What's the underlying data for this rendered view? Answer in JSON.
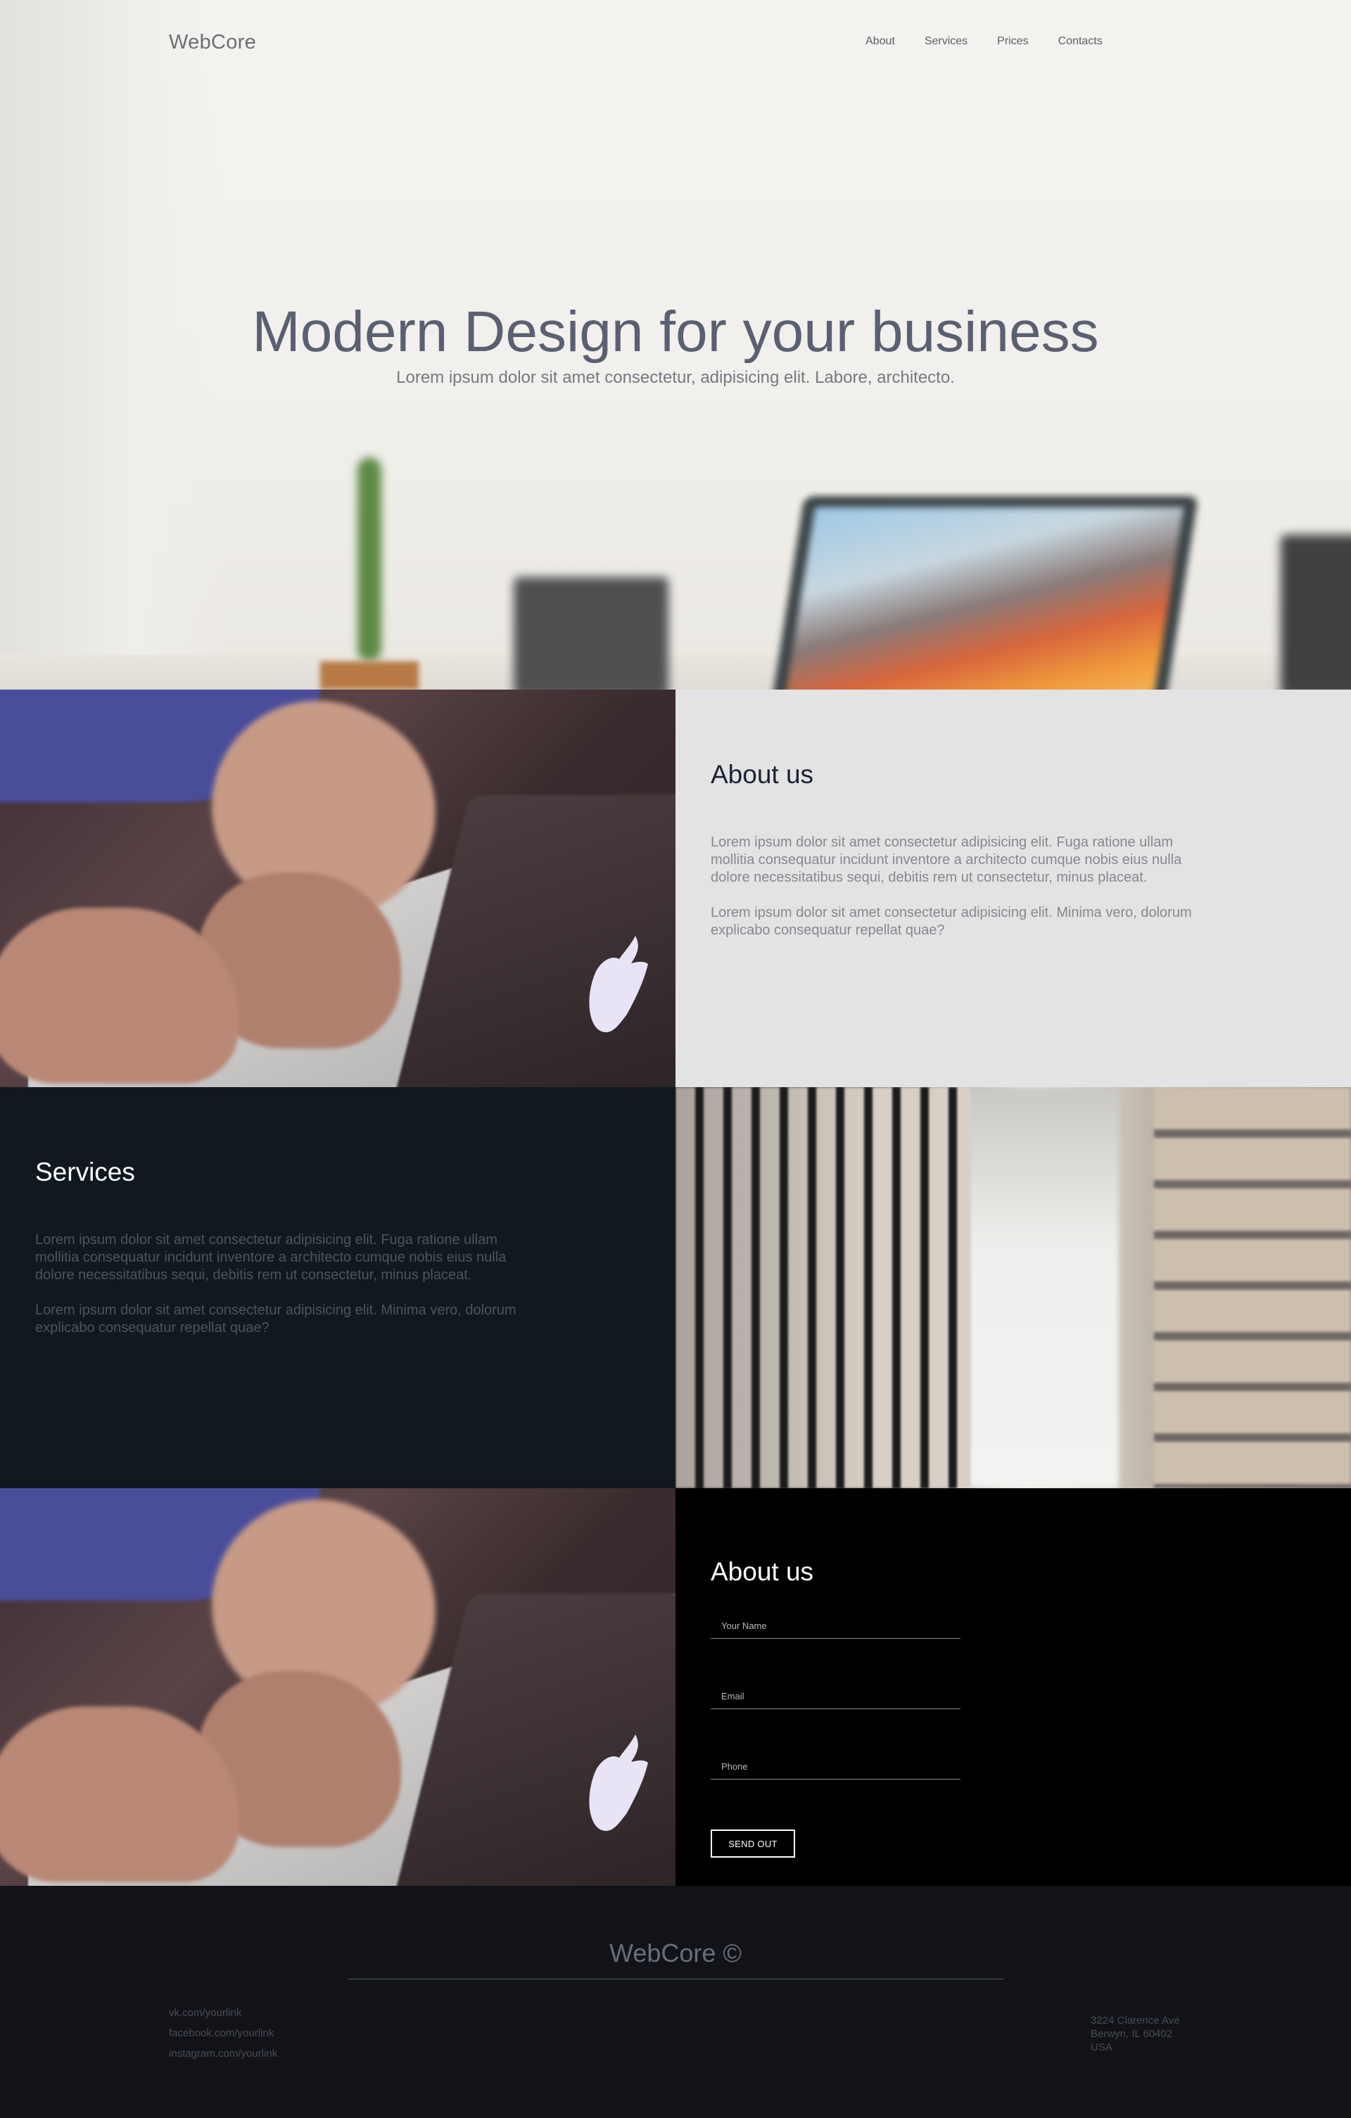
{
  "header": {
    "logo": "WebCore",
    "nav": [
      "About",
      "Services",
      "Prices",
      "Contacts"
    ]
  },
  "hero": {
    "title": "Modern Design for your business",
    "subtitle": "Lorem ipsum dolor sit amet consectetur, adipisicing elit. Labore, architecto."
  },
  "about": {
    "title": "About us",
    "paragraph1": "Lorem ipsum dolor sit amet consectetur adipisicing elit. Fuga ratione ullam mollitia consequatur incidunt inventore a architecto cumque nobis eius nulla dolore necessitatibus sequi, debitis rem ut consectetur, minus placeat.",
    "paragraph2": "Lorem ipsum dolor sit amet consectetur adipisicing elit. Minima vero, dolorum explicabo consequatur repellat quae?"
  },
  "services": {
    "title": "Services",
    "paragraph1": "Lorem ipsum dolor sit amet consectetur adipisicing elit. Fuga ratione ullam mollitia consequatur incidunt inventore a architecto cumque nobis eius nulla dolore necessitatibus sequi, debitis rem ut consectetur, minus placeat.",
    "paragraph2": "Lorem ipsum dolor sit amet consectetur adipisicing elit. Minima vero, dolorum explicabo consequatur repellat quae?"
  },
  "contact": {
    "title": "About us",
    "name_placeholder": "Your Name",
    "email_placeholder": "Email",
    "phone_placeholder": "Phone",
    "submit_label": "SEND OUT"
  },
  "footer": {
    "logo": "WebCore ©",
    "links": [
      "vk.com/yourlink",
      "facebook.com/yourlink",
      "instagram.com/yourlink"
    ],
    "address": [
      "3224 Clarence Ave",
      "Berwyn, IL 60402",
      "USA"
    ]
  },
  "colors": {
    "hero_title": "#5b5f72",
    "about_bg": "#e3e3e3",
    "services_bg": "#101820",
    "contact_bg": "#000000",
    "footer_bg": "#121319"
  }
}
